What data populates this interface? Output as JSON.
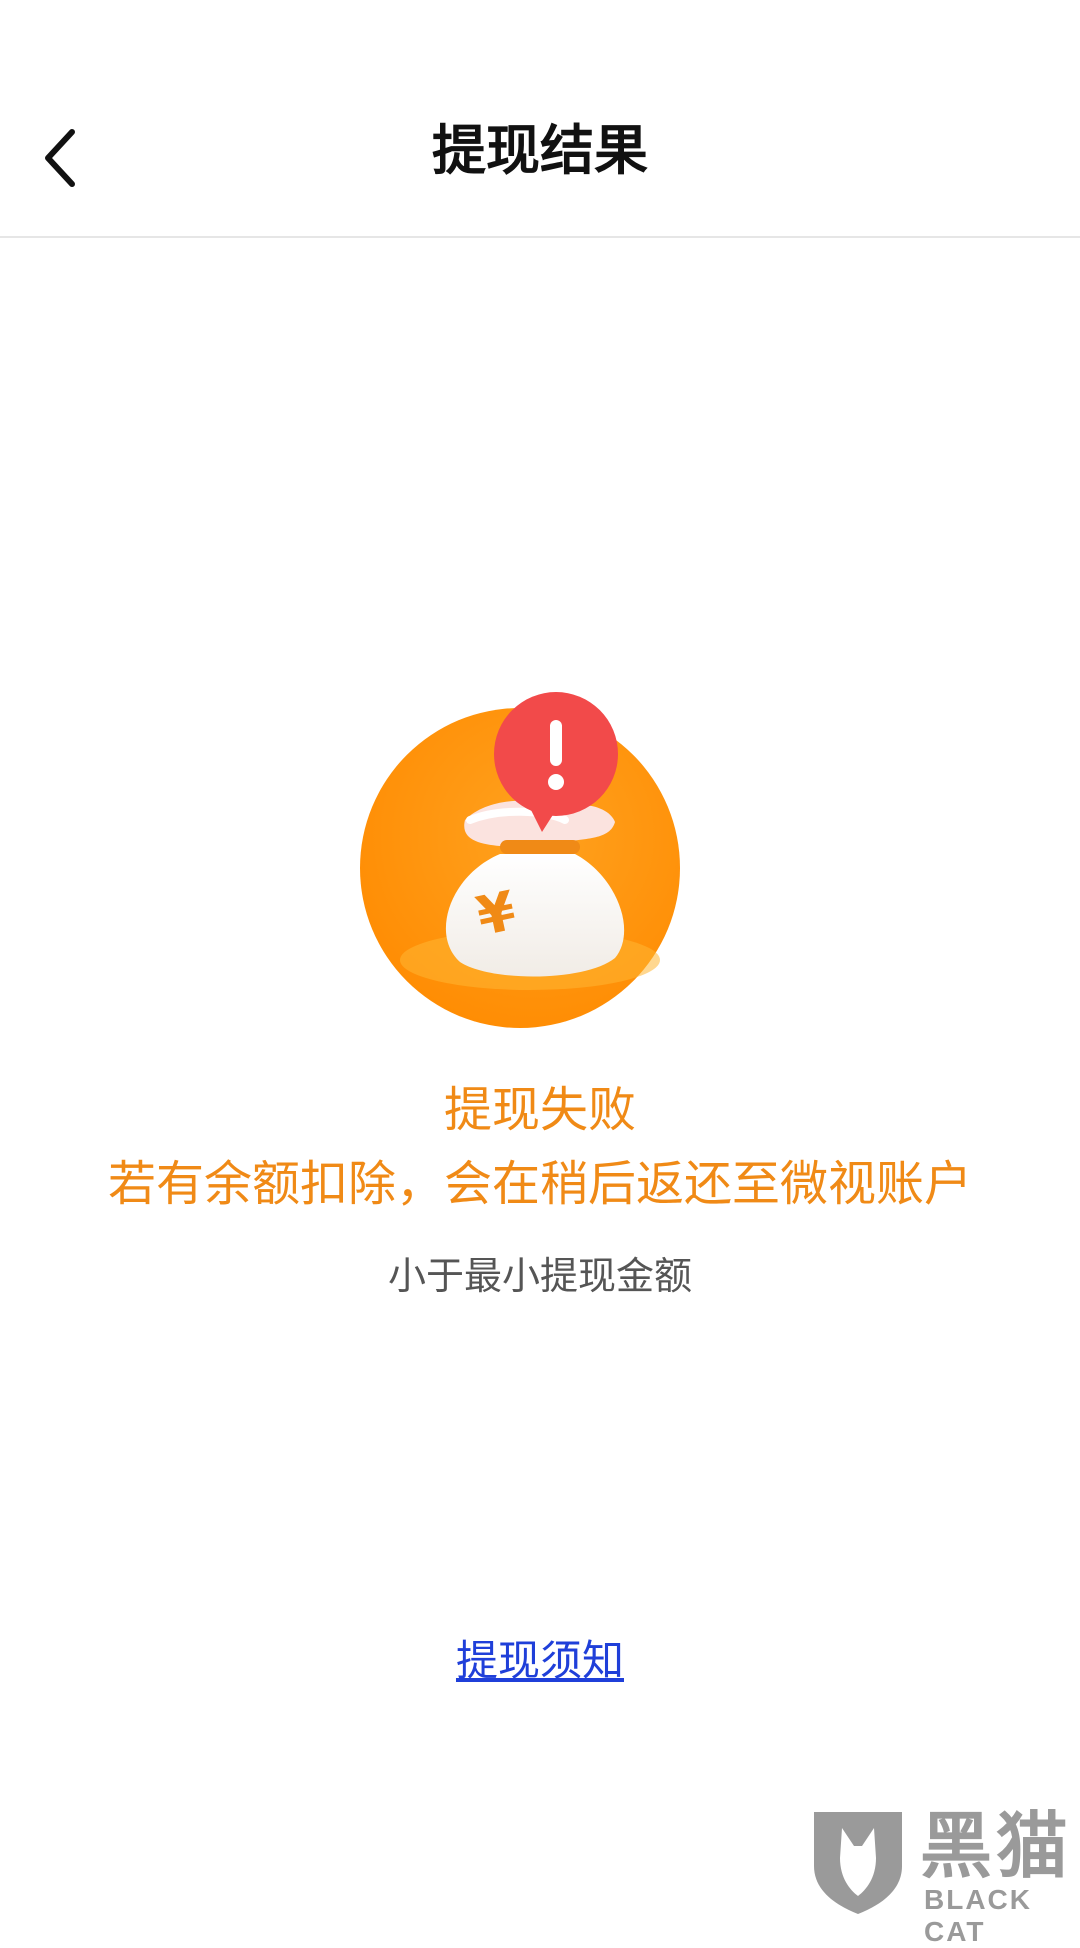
{
  "header": {
    "title": "提现结果",
    "back_icon": "chevron-left-icon"
  },
  "result": {
    "icon": "money-bag-alert-icon",
    "status_title": "提现失败",
    "status_desc": "若有余额扣除，会在稍后返还至微视账户",
    "reason": "小于最小提现金额"
  },
  "footer": {
    "notice_link": "提现须知"
  },
  "watermark": {
    "name_cn": "黑猫",
    "name_en": "BLACK CAT"
  },
  "colors": {
    "accent_orange": "#f08a16",
    "alert_red": "#f24a4a",
    "link_blue": "#1f3fd9"
  }
}
